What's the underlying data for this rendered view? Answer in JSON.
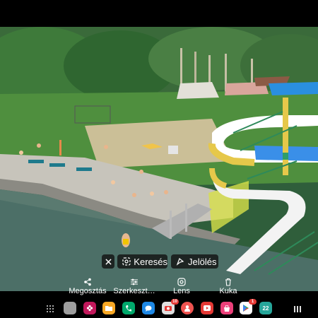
{
  "viewer": {
    "chips": {
      "close_icon": "close-icon",
      "search_label": "Keresés",
      "mark_label": "Jelölés"
    },
    "actions": [
      {
        "label": "Megosztás",
        "icon": "share-icon"
      },
      {
        "label": "Szerkeszt…",
        "icon": "edit-sliders-icon"
      },
      {
        "label": "Lens",
        "icon": "lens-icon"
      },
      {
        "label": "Kuka",
        "icon": "trash-icon"
      }
    ]
  },
  "navbar": {
    "apps": [
      {
        "name": "gallery",
        "color": "#9e9e9e",
        "badge": ""
      },
      {
        "name": "blossom",
        "color": "#c2185b",
        "badge": ""
      },
      {
        "name": "folder",
        "color": "#f9a825",
        "badge": ""
      },
      {
        "name": "phone",
        "color": "#00a86b",
        "badge": ""
      },
      {
        "name": "messages",
        "color": "#1e88e5",
        "badge": ""
      },
      {
        "name": "camera-app",
        "color": "#e0e0e0",
        "badge": "10"
      },
      {
        "name": "user-app",
        "color": "#ef5350",
        "badge": ""
      },
      {
        "name": "video",
        "color": "#e53935",
        "badge": ""
      },
      {
        "name": "store",
        "color": "#ec407a",
        "badge": ""
      },
      {
        "name": "play-store",
        "color": "#ffffff",
        "badge": "1"
      },
      {
        "name": "calendar",
        "color": "#26a69a",
        "badge": ""
      }
    ],
    "calendar_day": "22"
  }
}
